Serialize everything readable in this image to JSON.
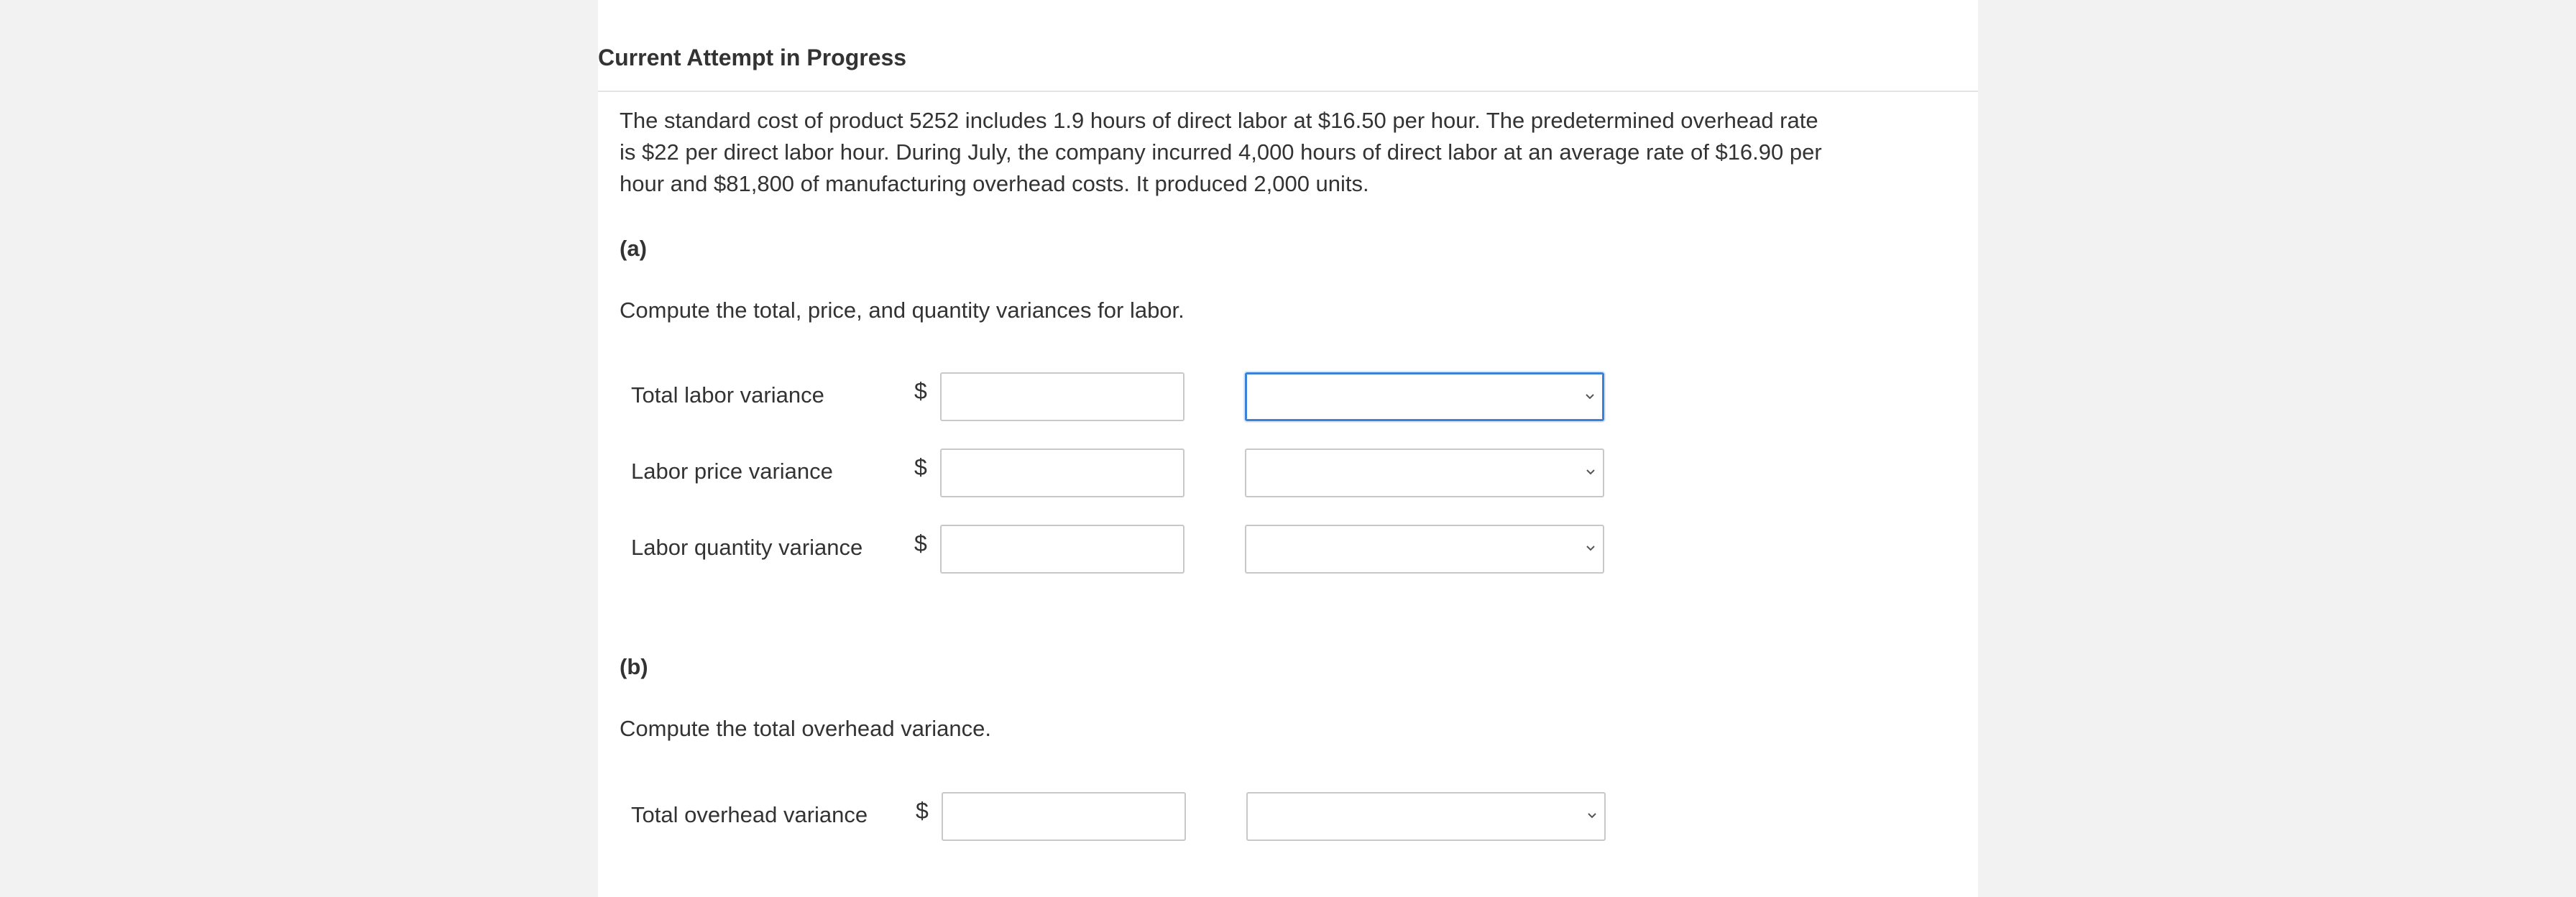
{
  "header": {
    "title": "Current Attempt in Progress"
  },
  "question": {
    "text": "The standard cost of product 5252 includes 1.9 hours of direct labor at $16.50 per hour. The predetermined overhead rate is $22 per direct labor hour. During July, the company incurred 4,000 hours of direct labor at an average rate of $16.90 per hour and $81,800 of manufacturing overhead costs. It produced 2,000 units."
  },
  "part_a": {
    "label": "(a)",
    "instruction": "Compute the total, price, and quantity variances for labor.",
    "rows": [
      {
        "label": "Total labor variance",
        "currency": "$",
        "amount": "",
        "selected": ""
      },
      {
        "label": "Labor price variance",
        "currency": "$",
        "amount": "",
        "selected": ""
      },
      {
        "label": "Labor quantity variance",
        "currency": "$",
        "amount": "",
        "selected": ""
      }
    ]
  },
  "part_b": {
    "label": "(b)",
    "instruction": "Compute the total overhead variance.",
    "rows": [
      {
        "label": "Total overhead variance",
        "currency": "$",
        "amount": "",
        "selected": ""
      }
    ]
  },
  "icons": {
    "dropdown": "chevron-down-icon"
  },
  "colors": {
    "background": "#f2f2f2",
    "panel": "#ffffff",
    "text": "#333333",
    "input_border": "#c8c8c8",
    "focus_border": "#3b82d6"
  }
}
